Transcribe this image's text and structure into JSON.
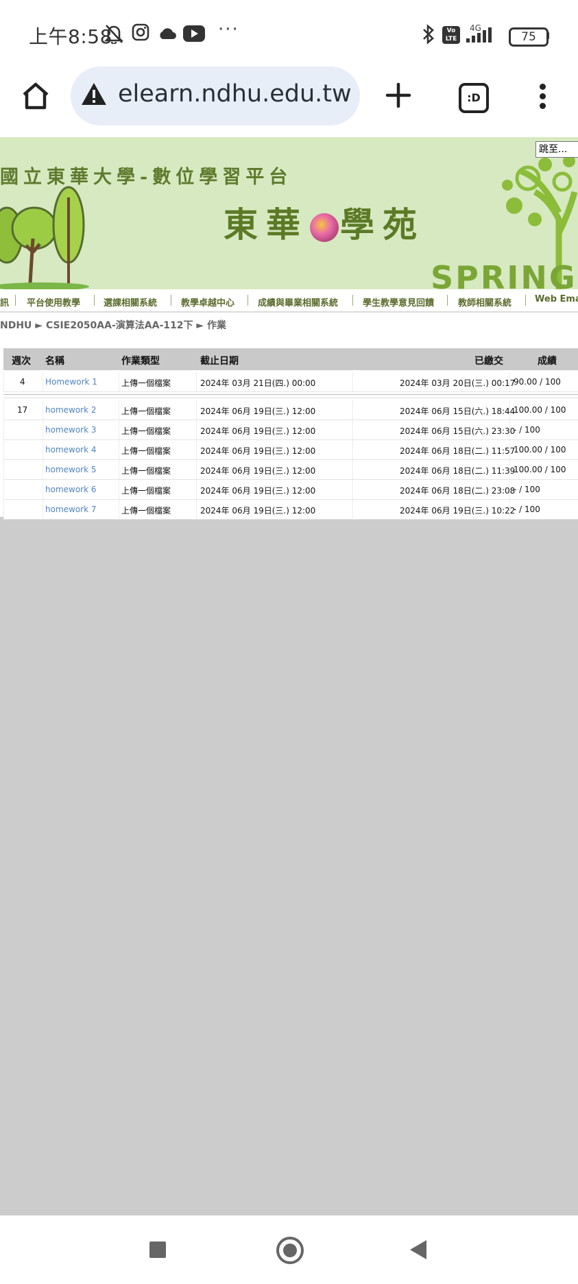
{
  "status_bar": {
    "time": "上午8:58",
    "dots": "···",
    "network": "4G",
    "volte": "Vo LTE",
    "battery": "75",
    "icons": [
      "bell-off-icon",
      "instagram-icon",
      "cloud-icon",
      "youtube-icon",
      "bluetooth-icon",
      "signal-icon",
      "battery-icon"
    ]
  },
  "browser": {
    "url": "elearn.ndhu.edu.tw/m",
    "tabs_label": ":D",
    "icons": [
      "home-icon",
      "warning-icon",
      "new-tab-icon",
      "tabs-icon",
      "menu-icon"
    ]
  },
  "banner": {
    "title": "國立東華大學-數位學習平台",
    "logo_left": "東華",
    "logo_right": "學苑",
    "season": "SPRING",
    "jump_button": "跳至..."
  },
  "nav": {
    "items": [
      "訊",
      "平台使用教學",
      "選課相關系統",
      "教學卓越中心",
      "成績與畢業相關系統",
      "學生教學意見回饋",
      "教師相關系統",
      "Web Email"
    ]
  },
  "breadcrumb": {
    "text": "NDHU ► CSIE2050AA-演算法AA-112下 ► 作業"
  },
  "table": {
    "headers": {
      "week": "週次",
      "name": "名稱",
      "type": "作業類型",
      "due": "截止日期",
      "submitted": "已繳交",
      "grade": "成績"
    },
    "rows": [
      {
        "week": "4",
        "name": "Homework 1",
        "type": "上傳一個檔案",
        "due": "2024年 03月 21日(四.) 00:00",
        "submitted": "2024年 03月 20日(三.) 00:17",
        "grade": "90.00 / 100"
      },
      {
        "week": "17",
        "name": "homework 2",
        "type": "上傳一個檔案",
        "due": "2024年 06月 19日(三.) 12:00",
        "submitted": "2024年 06月 15日(六.) 18:44",
        "grade": "100.00 / 100"
      },
      {
        "week": "",
        "name": "homework 3",
        "type": "上傳一個檔案",
        "due": "2024年 06月 19日(三.) 12:00",
        "submitted": "2024年 06月 15日(六.) 23:30",
        "grade": "- / 100"
      },
      {
        "week": "",
        "name": "homework 4",
        "type": "上傳一個檔案",
        "due": "2024年 06月 19日(三.) 12:00",
        "submitted": "2024年 06月 18日(二.) 11:57",
        "grade": "100.00 / 100"
      },
      {
        "week": "",
        "name": "homework 5",
        "type": "上傳一個檔案",
        "due": "2024年 06月 19日(三.) 12:00",
        "submitted": "2024年 06月 18日(二.) 11:39",
        "grade": "100.00 / 100"
      },
      {
        "week": "",
        "name": "homework 6",
        "type": "上傳一個檔案",
        "due": "2024年 06月 19日(三.) 12:00",
        "submitted": "2024年 06月 18日(二.) 23:08",
        "grade": "- / 100"
      },
      {
        "week": "",
        "name": "homework 7",
        "type": "上傳一個檔案",
        "due": "2024年 06月 19日(三.) 12:00",
        "submitted": "2024年 06月 19日(三.) 10:22",
        "grade": "- / 100"
      }
    ]
  },
  "system_nav": {
    "icons": [
      "recents-icon",
      "home-circle-icon",
      "back-icon"
    ]
  }
}
